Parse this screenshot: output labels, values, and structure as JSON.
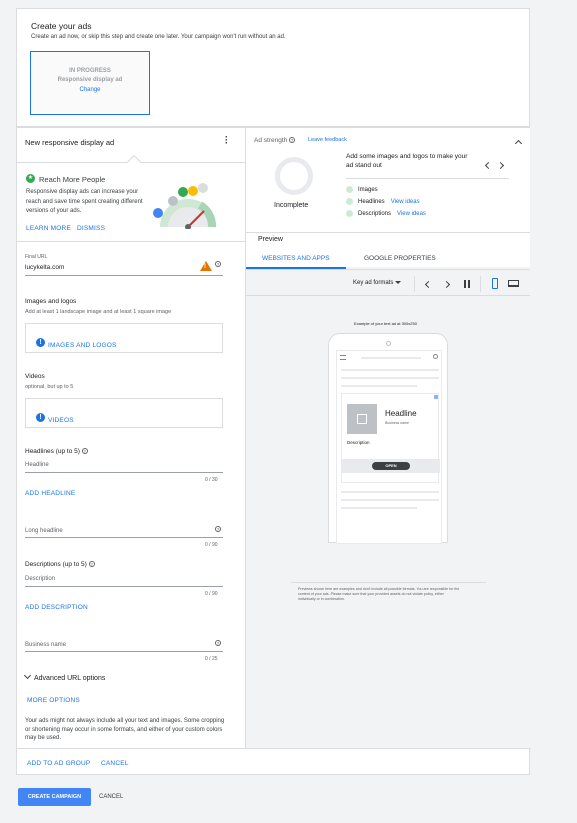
{
  "create_ads": {
    "title": "Create your ads",
    "subtitle": "Create an ad now, or skip this step and create one later. Your campaign won't run without an ad.",
    "card_status": "IN PROGRESS",
    "card_type": "Responsive display ad",
    "card_change": "Change"
  },
  "editor": {
    "title": "New responsive display ad",
    "promo_title": "Reach More People",
    "promo_text": "Responsive display ads can increase your reach and save time spent creating different versions of your ads.",
    "learn_more": "LEARN MORE",
    "dismiss": "DISMISS",
    "final_url_label": "Final URL",
    "final_url_value": "lucykelta.com",
    "images_title": "Images and logos",
    "images_hint": "Add at least 1 landscape image and at least 1 square image",
    "images_button": "IMAGES AND LOGOS",
    "videos_title": "Videos",
    "videos_hint": "optional, but up to 5",
    "videos_button": "VIDEOS",
    "headlines_title": "Headlines (up to 5)",
    "headline_placeholder": "Headline",
    "headline_count": "0 / 30",
    "add_headline": "ADD HEADLINE",
    "long_headline_placeholder": "Long headline",
    "long_headline_count": "0 / 90",
    "descriptions_title": "Descriptions (up to 5)",
    "description_placeholder": "Description",
    "description_count": "0 / 90",
    "add_description": "ADD DESCRIPTION",
    "business_name_placeholder": "Business name",
    "business_name_count": "0 / 25",
    "advanced_url": "Advanced URL options",
    "more_options": "MORE OPTIONS",
    "disclaimer": "Your ads might not always include all your text and images. Some cropping or shortening may occur in some formats, and either of your custom colors may be used."
  },
  "strength": {
    "title": "Ad strength",
    "leave_feedback": "Leave feedback",
    "status": "Incomplete",
    "tip": "Add some images and logos to make your ad stand out",
    "items": [
      {
        "label": "Images",
        "link": ""
      },
      {
        "label": "Headlines",
        "link": "View ideas"
      },
      {
        "label": "Descriptions",
        "link": "View ideas"
      }
    ]
  },
  "preview": {
    "title": "Preview",
    "tabs": [
      "WEBSITES AND APPS",
      "GOOGLE PROPERTIES"
    ],
    "active_tab": 0,
    "key_formats": "Key ad formats",
    "example_caption": "Example of your text ad at 300x250",
    "ad_headline": "Headline",
    "ad_business": "Business name",
    "ad_description": "Description",
    "ad_cta": "OPEN",
    "footnote": "Previews shown here are examples and don't include all possible formats. You are responsible for the content of your ads. Please make sure that your provided assets do not violate policy, either individually or in combination."
  },
  "footer": {
    "add_to_ad_group": "ADD TO AD GROUP",
    "cancel": "CANCEL",
    "create_campaign": "CREATE CAMPAIGN",
    "cancel_bottom": "CANCEL"
  },
  "colors": {
    "accent": "#1a73e8",
    "warning": "#e37400",
    "green": "#34a853"
  }
}
